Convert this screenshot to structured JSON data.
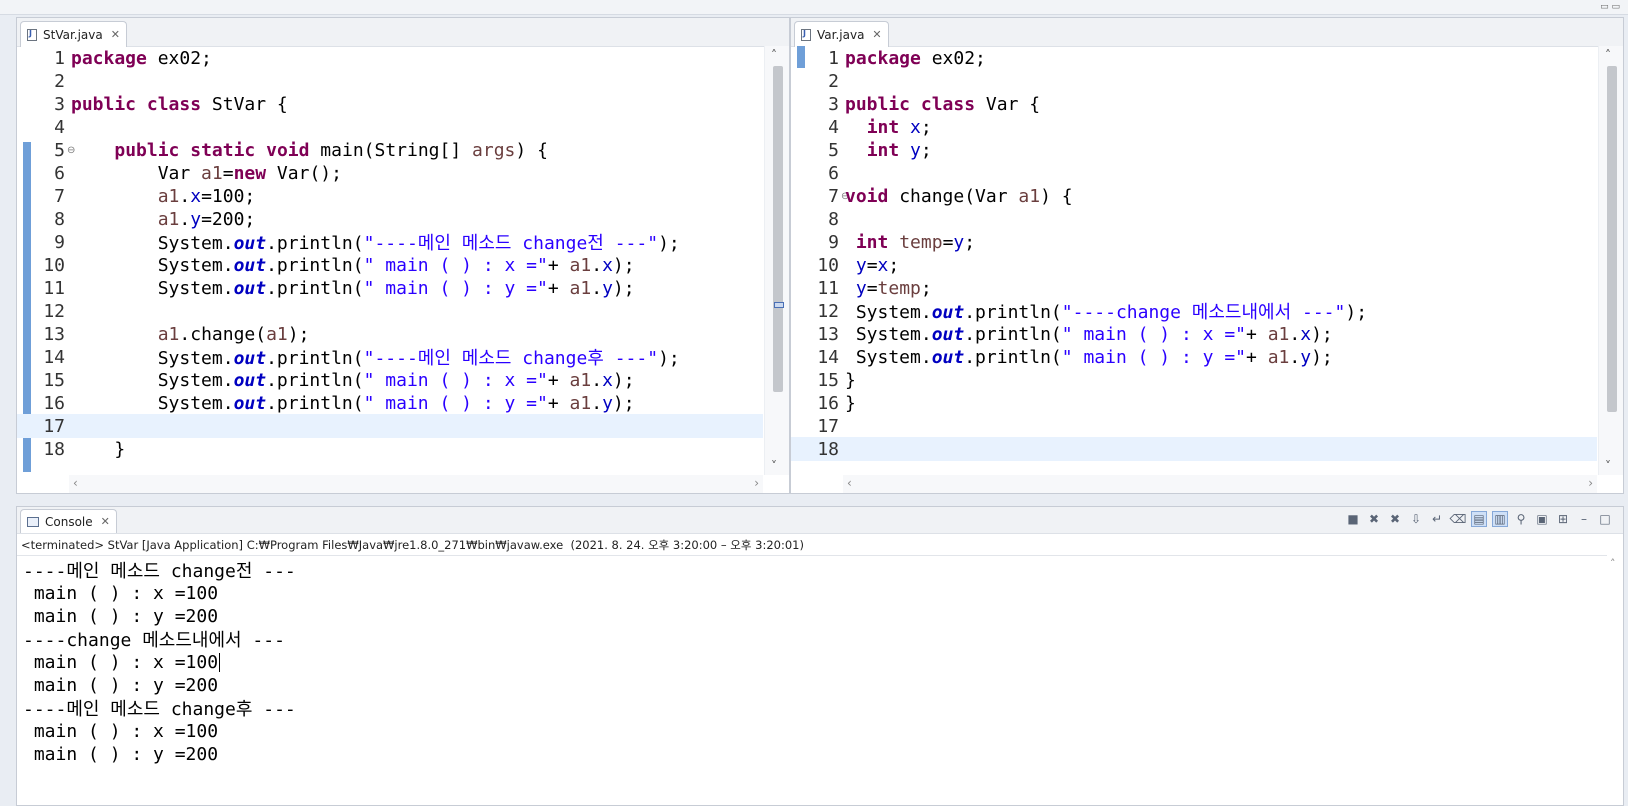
{
  "left_editor": {
    "tab_title": "StVar.java",
    "lines": [
      {
        "n": "1",
        "fold": "",
        "html": "<span class='kw'>package</span> ex02;"
      },
      {
        "n": "2",
        "fold": "",
        "html": ""
      },
      {
        "n": "3",
        "fold": "",
        "html": "<span class='kw'>public</span> <span class='kw'>class</span> StVar {"
      },
      {
        "n": "4",
        "fold": "",
        "html": ""
      },
      {
        "n": "5",
        "fold": "⊖",
        "html": "    <span class='kw'>public</span> <span class='kw'>static</span> <span class='kw'>void</span> main(String[] <span class='loc'>args</span>) {"
      },
      {
        "n": "6",
        "fold": "",
        "html": "        Var <span class='loc'>a1</span>=<span class='kw'>new</span> Var();"
      },
      {
        "n": "7",
        "fold": "",
        "html": "        <span class='loc'>a1</span>.<span class='fld'>x</span>=100;"
      },
      {
        "n": "8",
        "fold": "",
        "html": "        <span class='loc'>a1</span>.<span class='fld'>y</span>=200;"
      },
      {
        "n": "9",
        "fold": "",
        "html": "        System.<span class='static'>out</span>.println(<span class='str'>\"----메인 메소드 change전 ---\"</span>);"
      },
      {
        "n": "10",
        "fold": "",
        "html": "        System.<span class='static'>out</span>.println(<span class='str'>\" main ( ) : x =\"</span>+ <span class='loc'>a1</span>.<span class='fld'>x</span>);"
      },
      {
        "n": "11",
        "fold": "",
        "html": "        System.<span class='static'>out</span>.println(<span class='str'>\" main ( ) : y =\"</span>+ <span class='loc'>a1</span>.<span class='fld'>y</span>);"
      },
      {
        "n": "12",
        "fold": "",
        "html": ""
      },
      {
        "n": "13",
        "fold": "",
        "html": "        <span class='loc'>a1</span>.change(<span class='loc'>a1</span>);"
      },
      {
        "n": "14",
        "fold": "",
        "html": "        System.<span class='static'>out</span>.println(<span class='str'>\"----메인 메소드 change후 ---\"</span>);"
      },
      {
        "n": "15",
        "fold": "",
        "html": "        System.<span class='static'>out</span>.println(<span class='str'>\" main ( ) : x =\"</span>+ <span class='loc'>a1</span>.<span class='fld'>x</span>);"
      },
      {
        "n": "16",
        "fold": "",
        "html": "        System.<span class='static'>out</span>.println(<span class='str'>\" main ( ) : y =\"</span>+ <span class='loc'>a1</span>.<span class='fld'>y</span>);"
      },
      {
        "n": "17",
        "fold": "",
        "html": "",
        "current": true
      },
      {
        "n": "18",
        "fold": "",
        "html": "    }"
      }
    ]
  },
  "right_editor": {
    "tab_title": "Var.java",
    "lines": [
      {
        "n": "1",
        "fold": "",
        "html": "<span class='kw'>package</span> ex02;"
      },
      {
        "n": "2",
        "fold": "",
        "html": ""
      },
      {
        "n": "3",
        "fold": "",
        "html": "<span class='kw'>public</span> <span class='kw'>class</span> Var {"
      },
      {
        "n": "4",
        "fold": "",
        "html": "  <span class='kw'>int</span> <span class='fld'>x</span>;"
      },
      {
        "n": "5",
        "fold": "",
        "html": "  <span class='kw'>int</span> <span class='fld'>y</span>;"
      },
      {
        "n": "6",
        "fold": "",
        "html": ""
      },
      {
        "n": "7",
        "fold": "⊖",
        "html": "<span class='kw'>void</span> change(Var <span class='loc'>a1</span>) {"
      },
      {
        "n": "8",
        "fold": "",
        "html": ""
      },
      {
        "n": "9",
        "fold": "",
        "html": " <span class='kw'>int</span> <span class='loc'>temp</span>=<span class='fld'>y</span>;"
      },
      {
        "n": "10",
        "fold": "",
        "html": " <span class='fld'>y</span>=<span class='fld'>x</span>;"
      },
      {
        "n": "11",
        "fold": "",
        "html": " <span class='fld'>y</span>=<span class='loc'>temp</span>;"
      },
      {
        "n": "12",
        "fold": "",
        "html": " System.<span class='static'>out</span>.println(<span class='str'>\"----change 메소드내에서 ---\"</span>);"
      },
      {
        "n": "13",
        "fold": "",
        "html": " System.<span class='static'>out</span>.println(<span class='str'>\" main ( ) : x =\"</span>+ <span class='loc'>a1</span>.<span class='fld'>x</span>);"
      },
      {
        "n": "14",
        "fold": "",
        "html": " System.<span class='static'>out</span>.println(<span class='str'>\" main ( ) : y =\"</span>+ <span class='loc'>a1</span>.<span class='fld'>y</span>);"
      },
      {
        "n": "15",
        "fold": "",
        "html": "}"
      },
      {
        "n": "16",
        "fold": "",
        "html": "}"
      },
      {
        "n": "17",
        "fold": "",
        "html": ""
      },
      {
        "n": "18",
        "fold": "",
        "html": "",
        "current": true
      }
    ]
  },
  "console": {
    "tab_title": "Console",
    "status": "<terminated> StVar [Java Application] C:₩Program Files₩Java₩jre1.8.0_271₩bin₩javaw.exe  (2021. 8. 24. 오후 3:20:00 – 오후 3:20:01)",
    "output": [
      "----메인 메소드 change전 ---",
      " main ( ) : x =100",
      " main ( ) : y =200",
      "----change 메소드내에서 ---",
      " main ( ) : x =100",
      " main ( ) : y =200",
      "----메인 메소드 change후 ---",
      " main ( ) : x =100",
      " main ( ) : y =200"
    ],
    "toolbar_icons": [
      "terminate-icon",
      "remove-launch-icon",
      "remove-all-icon",
      "scroll-lock-icon",
      "word-wrap-icon",
      "clear-console-icon",
      "show-on-stdout-icon",
      "show-on-stderr-icon",
      "pin-console-icon",
      "display-console-icon",
      "open-console-icon",
      "minimize-icon",
      "maximize-icon"
    ]
  }
}
